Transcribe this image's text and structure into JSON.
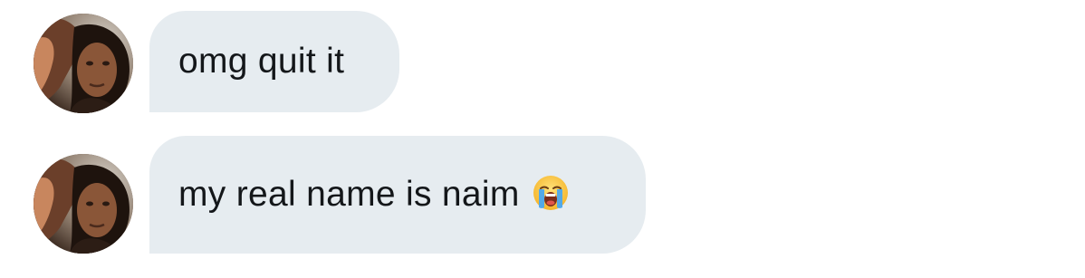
{
  "conversation": {
    "messages": [
      {
        "text": "omg quit it",
        "avatar_icon": "user-avatar-photo"
      },
      {
        "text": "my real name is naim",
        "avatar_icon": "user-avatar-photo",
        "emoji_icon": "loudly-crying-face-emoji"
      }
    ]
  },
  "colors": {
    "bubble_background": "#e6ecf0",
    "text": "#14171a",
    "page_background": "#ffffff"
  }
}
